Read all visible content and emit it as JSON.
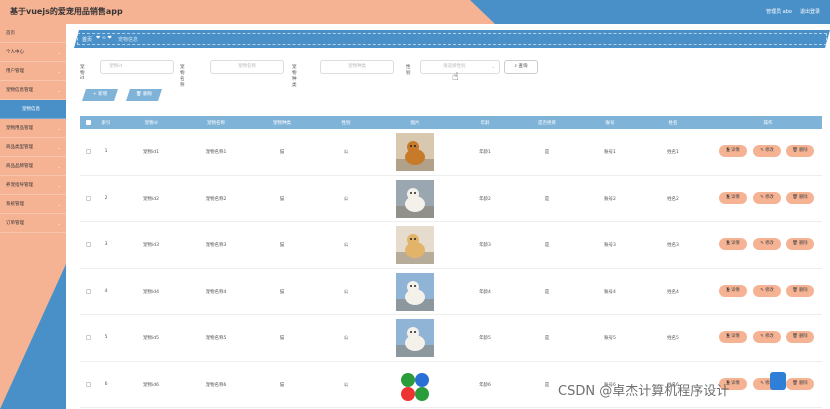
{
  "app": {
    "title": "基于vuejs的爱宠用品销售app",
    "admin_label": "管理员 abo",
    "logout_label": "退出登录"
  },
  "sidebar": {
    "items": [
      {
        "label": "首页",
        "chevron": false
      },
      {
        "label": "个人中心",
        "chevron": true
      },
      {
        "label": "用户管理",
        "chevron": true
      },
      {
        "label": "宠物信息管理",
        "chevron": true
      },
      {
        "label": "宠物信息",
        "chevron": false,
        "sub": true
      },
      {
        "label": "宠物用品管理",
        "chevron": true
      },
      {
        "label": "商品类型管理",
        "chevron": true
      },
      {
        "label": "商品品牌管理",
        "chevron": true
      },
      {
        "label": "养宠指导管理",
        "chevron": true
      },
      {
        "label": "系统管理",
        "chevron": true
      },
      {
        "label": "订单管理",
        "chevron": true
      }
    ]
  },
  "breadcrumb": {
    "home": "首页",
    "separator": "❤ ∞ ❤",
    "current": "宠物信息"
  },
  "filters": {
    "pet_id_label": "宠物id",
    "pet_id_placeholder": "宠物id",
    "pet_name_label": "宠物名称",
    "pet_name_placeholder": "宠物名称",
    "pet_breed_label": "宠物种类",
    "pet_breed_placeholder": "宠物种类",
    "gender_label": "性别",
    "gender_placeholder": "请选择性别",
    "query_label": "查询"
  },
  "toolbar": {
    "add_label": "新增",
    "delete_label": "删除"
  },
  "table": {
    "columns": [
      "索引",
      "宠物id",
      "宠物名称",
      "宠物种类",
      "性别",
      "图片",
      "年龄",
      "是否绝育",
      "账号",
      "姓名",
      "操作"
    ],
    "rows": [
      {
        "index": "1",
        "pet_id": "宠物id1",
        "pet_name": "宠物名称1",
        "breed": "猫",
        "gender": "公",
        "age": "年龄1",
        "neutered": "是",
        "account": "账号1",
        "name": "姓名1",
        "image": "dog-photo-1"
      },
      {
        "index": "2",
        "pet_id": "宠物id2",
        "pet_name": "宠物名称2",
        "breed": "猫",
        "gender": "公",
        "age": "年龄2",
        "neutered": "是",
        "account": "账号2",
        "name": "姓名2",
        "image": "dog-photo-2"
      },
      {
        "index": "3",
        "pet_id": "宠物id3",
        "pet_name": "宠物名称3",
        "breed": "猫",
        "gender": "公",
        "age": "年龄3",
        "neutered": "是",
        "account": "账号3",
        "name": "姓名3",
        "image": "dog-photo-3"
      },
      {
        "index": "4",
        "pet_id": "宠物id4",
        "pet_name": "宠物名称4",
        "breed": "猫",
        "gender": "公",
        "age": "年龄4",
        "neutered": "是",
        "account": "账号4",
        "name": "姓名4",
        "image": "dog-photo-4"
      },
      {
        "index": "5",
        "pet_id": "宠物id5",
        "pet_name": "宠物名称5",
        "breed": "猫",
        "gender": "公",
        "age": "年龄5",
        "neutered": "是",
        "account": "账号5",
        "name": "姓名5",
        "image": "dog-photo-5"
      },
      {
        "index": "6",
        "pet_id": "宠物id6",
        "pet_name": "宠物名称6",
        "breed": "猫",
        "gender": "公",
        "age": "年龄6",
        "neutered": "是",
        "account": "账号6",
        "name": "姓名6",
        "image": "toy-balls-photo"
      }
    ],
    "actions": {
      "detail": "详情",
      "edit": "修改",
      "delete": "删除"
    }
  },
  "watermark": "CSDN @卓杰计算机程序设计",
  "colors": {
    "peach": "#f6b394",
    "blue": "#4a90c8",
    "header_blue": "#7fb3d8"
  }
}
